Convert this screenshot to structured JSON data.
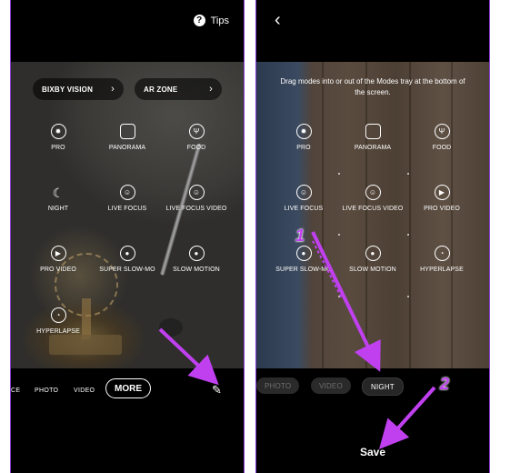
{
  "left_screen": {
    "tips_label": "Tips",
    "tips_icon": "question-icon",
    "pills": [
      {
        "label": "BIXBY VISION"
      },
      {
        "label": "AR ZONE"
      }
    ],
    "modes": [
      {
        "label": "PRO",
        "icon": "aperture-icon"
      },
      {
        "label": "PANORAMA",
        "icon": "panorama-icon"
      },
      {
        "label": "FOOD",
        "icon": "food-icon"
      },
      {
        "label": "NIGHT",
        "icon": "moon-icon"
      },
      {
        "label": "LIVE FOCUS",
        "icon": "live-focus-icon"
      },
      {
        "label": "LIVE FOCUS VIDEO",
        "icon": "live-focus-video-icon"
      },
      {
        "label": "PRO VIDEO",
        "icon": "play-icon"
      },
      {
        "label": "SUPER SLOW-MO",
        "icon": "toggle-icon"
      },
      {
        "label": "SLOW MOTION",
        "icon": "record-icon"
      },
      {
        "label": "HYPERLAPSE",
        "icon": "timer-icon"
      }
    ],
    "mode_bar": {
      "partial_item": "CE",
      "items": [
        "PHOTO",
        "VIDEO"
      ],
      "active": "MORE",
      "edit_icon": "pencil-icon"
    }
  },
  "right_screen": {
    "back_icon": "chevron-left-icon",
    "helper_text": "Drag modes into or out of the Modes tray at the bottom of the screen.",
    "modes": [
      {
        "label": "PRO",
        "icon": "aperture-icon"
      },
      {
        "label": "PANORAMA",
        "icon": "panorama-icon"
      },
      {
        "label": "FOOD",
        "icon": "food-icon"
      },
      {
        "label": "LIVE FOCUS",
        "icon": "live-focus-icon"
      },
      {
        "label": "LIVE FOCUS VIDEO",
        "icon": "live-focus-video-icon"
      },
      {
        "label": "PRO VIDEO",
        "icon": "play-icon"
      },
      {
        "label": "SUPER SLOW-MO",
        "icon": "toggle-icon"
      },
      {
        "label": "SLOW MOTION",
        "icon": "record-icon"
      },
      {
        "label": "HYPERLAPSE",
        "icon": "timer-icon"
      }
    ],
    "tray": [
      {
        "label": "PHOTO",
        "state": "dim"
      },
      {
        "label": "VIDEO",
        "state": "dim"
      },
      {
        "label": "NIGHT",
        "state": "active"
      }
    ],
    "save_label": "Save"
  },
  "annotations": {
    "step1": "1",
    "step2": "2",
    "color": "#c040f0"
  }
}
